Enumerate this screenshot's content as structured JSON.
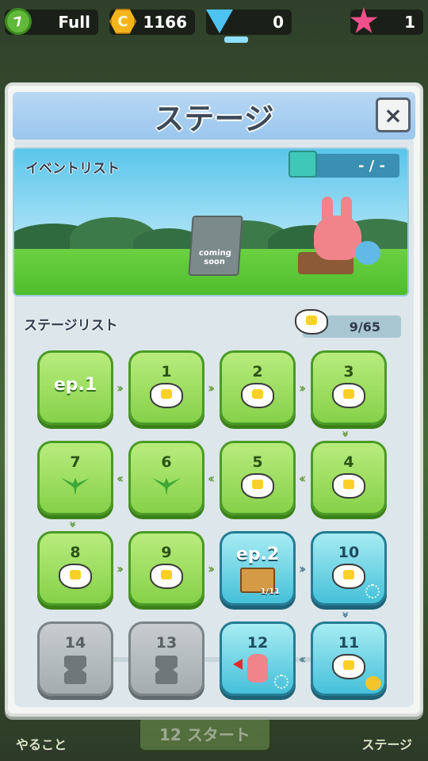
{
  "topbar": {
    "hearts": {
      "icon": "clover-icon",
      "level": "7",
      "value": "Full"
    },
    "coins": {
      "icon": "coin-icon",
      "value": "1166"
    },
    "gems": {
      "icon": "gem-icon",
      "value": "0"
    },
    "stars": {
      "icon": "pink-star-icon",
      "value": "1"
    }
  },
  "background": {
    "start_label": "スタート",
    "bottom_left_label": "やること",
    "bottom_right_label": "ステージ",
    "badge_label": "12"
  },
  "modal": {
    "title": "ステージ",
    "close_label": "×"
  },
  "event": {
    "title": "イベントリスト",
    "counter": "- / -",
    "coming_soon_1": "coming",
    "coming_soon_2": "soon"
  },
  "stage_list": {
    "title": "ステージリスト",
    "flower_count": "9/65",
    "tiles": {
      "ep1": "ep.1",
      "s1": "1",
      "s2": "2",
      "s3": "3",
      "s4": "4",
      "s5": "5",
      "s6": "6",
      "s7": "7",
      "s8": "8",
      "s9": "9",
      "ep2": "ep.2",
      "ep2_progress": "1/11",
      "s10": "10",
      "s11": "11",
      "s12": "12",
      "s13": "13",
      "s14": "14"
    }
  },
  "colors": {
    "green_tile": "#86d149",
    "blue_tile": "#45c0d9",
    "grey_tile": "#a4acb0",
    "header_blue": "#9ac6ee"
  }
}
